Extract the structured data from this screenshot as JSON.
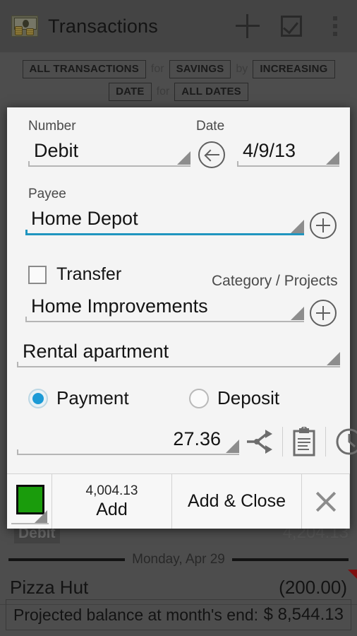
{
  "app": {
    "title": "Transactions",
    "icon": "money-bill-coins-icon",
    "actions": [
      {
        "name": "add-transaction-button",
        "icon": "plus-icon"
      },
      {
        "name": "select-mode-button",
        "icon": "checkbox-checked-icon"
      },
      {
        "name": "overflow-menu-button",
        "icon": "more-vert-icon"
      }
    ]
  },
  "filters": {
    "row1": {
      "scope": "ALL TRANSACTIONS",
      "for_word": "for",
      "account": "SAVINGS",
      "by_word": "by",
      "order": "INCREASING"
    },
    "row2": {
      "sort_field": "DATE",
      "for_word": "for",
      "range": "ALL DATES"
    }
  },
  "dialog": {
    "number": {
      "label": "Number",
      "value": "Debit"
    },
    "date": {
      "label": "Date",
      "value": "4/9/13",
      "back_icon": "circle-arrow-left-icon"
    },
    "payee": {
      "label": "Payee",
      "value": "Home Depot",
      "add_icon": "circle-plus-icon"
    },
    "transfer": {
      "label": "Transfer",
      "checked": false
    },
    "category": {
      "label": "Category / Projects",
      "value": "Home Improvements",
      "add_icon": "circle-plus-icon"
    },
    "project": {
      "value": "Rental apartment"
    },
    "type": {
      "payment_label": "Payment",
      "deposit_label": "Deposit",
      "selected": "Payment"
    },
    "amount": {
      "value": "27.36"
    },
    "amount_actions": [
      {
        "name": "split-transaction-button",
        "icon": "split-arrows-icon"
      },
      {
        "name": "memo-button",
        "icon": "clipboard-notes-icon"
      },
      {
        "name": "recurring-button",
        "icon": "clock-icon"
      }
    ],
    "buttons": {
      "color_swatch": {
        "name": "color-swatch",
        "color": "#1a9c0c"
      },
      "add": {
        "running_total": "4,004.13",
        "label": "Add"
      },
      "add_close": {
        "label": "Add & Close"
      },
      "close": {
        "icon": "close-x-icon"
      }
    }
  },
  "background_list": {
    "partial_row": {
      "tag": "Debit",
      "amount": "4,204.13"
    },
    "day_separator": "Monday, Apr 29",
    "rows": [
      {
        "payee": "Pizza Hut",
        "amount": "(200.00)",
        "flagged": true
      }
    ],
    "footer": {
      "label": "Projected balance at month's end:",
      "value": "$ 8,544.13"
    }
  },
  "colors": {
    "accent_blue": "#1b9ad6",
    "underline_active": "#2095bf",
    "swatch_green": "#1a9c0c",
    "flag_red": "#b51616"
  }
}
